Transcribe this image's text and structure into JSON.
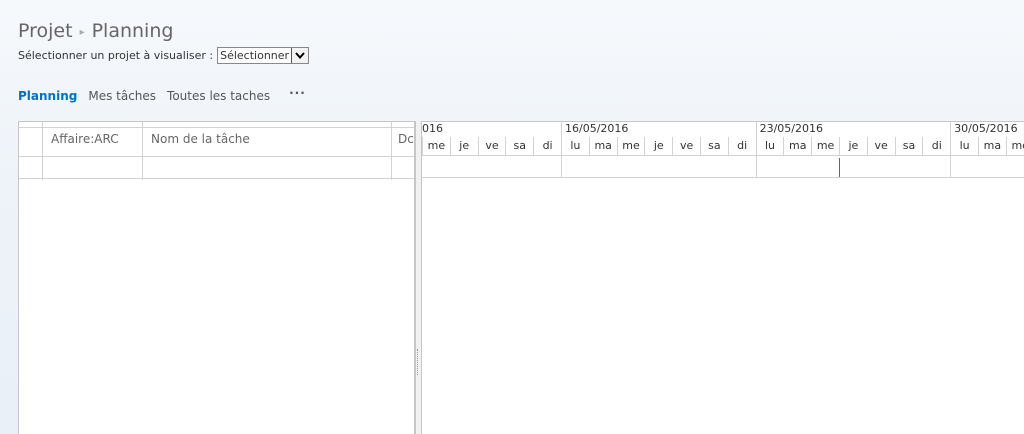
{
  "header": {
    "breadcrumb_root": "Projet",
    "breadcrumb_sep": "▸",
    "breadcrumb_current": "Planning",
    "selector_label": "Sélectionner un projet à visualiser :",
    "selector_value": "Sélectionner"
  },
  "tabs": [
    {
      "label": "Planning",
      "active": true
    },
    {
      "label": "Mes tâches",
      "active": false
    },
    {
      "label": "Toutes les taches",
      "active": false
    }
  ],
  "more_label": "···",
  "grid": {
    "columns": [
      {
        "label": ""
      },
      {
        "label": "Affaire:ARC"
      },
      {
        "label": "Nom de la tâche"
      },
      {
        "label": "Dc"
      }
    ]
  },
  "gantt": {
    "weeks": [
      "016",
      "16/05/2016",
      "23/05/2016",
      "30/05/2016"
    ],
    "days": [
      "me",
      "je",
      "ve",
      "sa",
      "di",
      "lu",
      "ma",
      "me",
      "je",
      "ve",
      "sa",
      "di",
      "lu",
      "ma",
      "me",
      "je",
      "ve",
      "sa",
      "di",
      "lu",
      "ma",
      "me"
    ]
  }
}
